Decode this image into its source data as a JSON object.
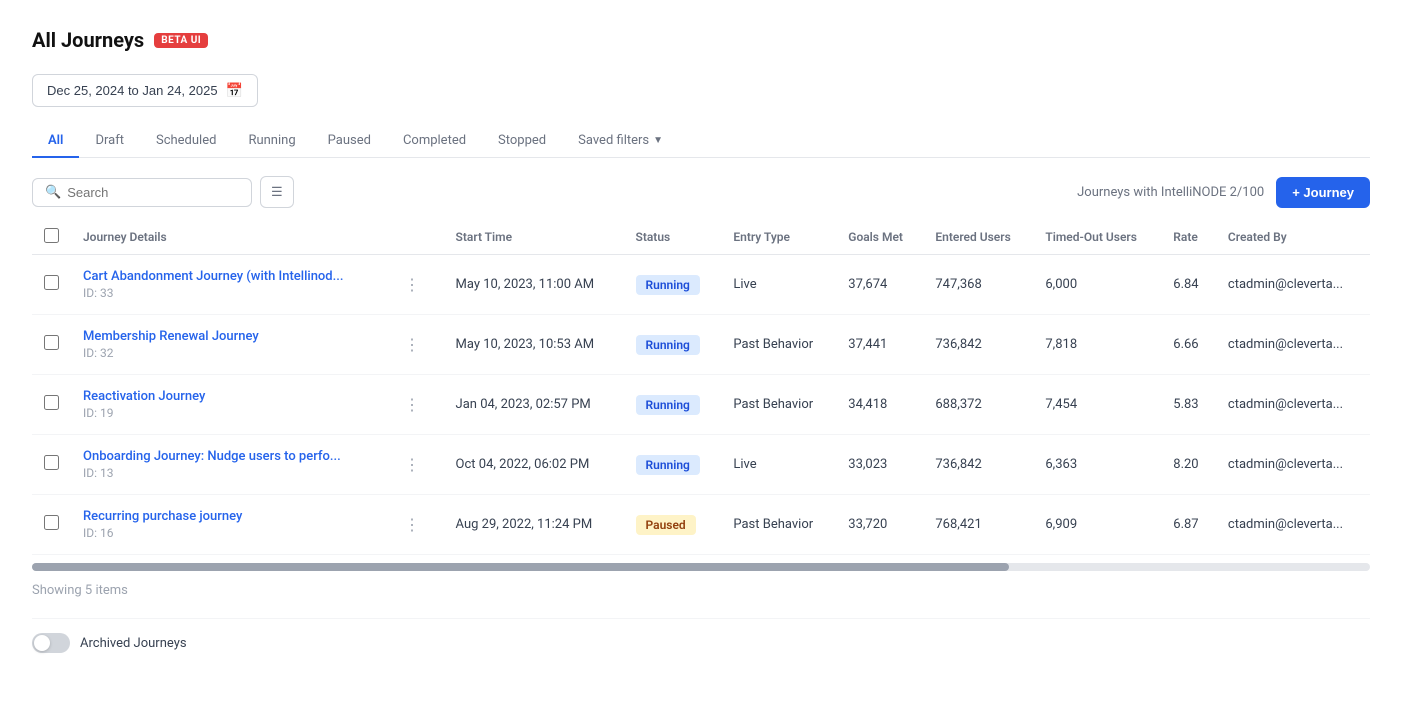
{
  "page": {
    "title": "All Journeys",
    "beta_badge": "BETA UI"
  },
  "date_range": {
    "label": "Dec 25, 2024 to Jan 24, 2025"
  },
  "tabs": [
    {
      "id": "all",
      "label": "All",
      "active": true
    },
    {
      "id": "draft",
      "label": "Draft",
      "active": false
    },
    {
      "id": "scheduled",
      "label": "Scheduled",
      "active": false
    },
    {
      "id": "running",
      "label": "Running",
      "active": false
    },
    {
      "id": "paused",
      "label": "Paused",
      "active": false
    },
    {
      "id": "completed",
      "label": "Completed",
      "active": false
    },
    {
      "id": "stopped",
      "label": "Stopped",
      "active": false
    },
    {
      "id": "saved_filters",
      "label": "Saved filters",
      "active": false
    }
  ],
  "toolbar": {
    "search_placeholder": "Search",
    "intellinode_text": "Journeys with IntelliNODE 2/100",
    "add_journey_label": "+ Journey"
  },
  "table": {
    "columns": [
      {
        "id": "checkbox",
        "label": ""
      },
      {
        "id": "journey_details",
        "label": "Journey Details"
      },
      {
        "id": "menu",
        "label": ""
      },
      {
        "id": "start_time",
        "label": "Start Time"
      },
      {
        "id": "status",
        "label": "Status"
      },
      {
        "id": "entry_type",
        "label": "Entry Type"
      },
      {
        "id": "goals_met",
        "label": "Goals Met"
      },
      {
        "id": "entered_users",
        "label": "Entered Users"
      },
      {
        "id": "timed_out_users",
        "label": "Timed-Out Users"
      },
      {
        "id": "rate",
        "label": "Rate"
      },
      {
        "id": "created_by",
        "label": "Created By"
      }
    ],
    "rows": [
      {
        "name": "Cart Abandonment Journey (with Intellinod...",
        "id": "ID: 33",
        "start_time": "May 10, 2023, 11:00 AM",
        "status": "Running",
        "status_type": "running",
        "entry_type": "Live",
        "goals_met": "37,674",
        "entered_users": "747,368",
        "timed_out_users": "6,000",
        "rate": "6.84",
        "created_by": "ctadmin@cleverta..."
      },
      {
        "name": "Membership Renewal Journey",
        "id": "ID: 32",
        "start_time": "May 10, 2023, 10:53 AM",
        "status": "Running",
        "status_type": "running",
        "entry_type": "Past Behavior",
        "goals_met": "37,441",
        "entered_users": "736,842",
        "timed_out_users": "7,818",
        "rate": "6.66",
        "created_by": "ctadmin@cleverta..."
      },
      {
        "name": "Reactivation Journey",
        "id": "ID: 19",
        "start_time": "Jan 04, 2023, 02:57 PM",
        "status": "Running",
        "status_type": "running",
        "entry_type": "Past Behavior",
        "goals_met": "34,418",
        "entered_users": "688,372",
        "timed_out_users": "7,454",
        "rate": "5.83",
        "created_by": "ctadmin@cleverta..."
      },
      {
        "name": "Onboarding Journey: Nudge users to perfo...",
        "id": "ID: 13",
        "start_time": "Oct 04, 2022, 06:02 PM",
        "status": "Running",
        "status_type": "running",
        "entry_type": "Live",
        "goals_met": "33,023",
        "entered_users": "736,842",
        "timed_out_users": "6,363",
        "rate": "8.20",
        "created_by": "ctadmin@cleverta..."
      },
      {
        "name": "Recurring purchase journey",
        "id": "ID: 16",
        "start_time": "Aug 29, 2022, 11:24 PM",
        "status": "Paused",
        "status_type": "paused",
        "entry_type": "Past Behavior",
        "goals_met": "33,720",
        "entered_users": "768,421",
        "timed_out_users": "6,909",
        "rate": "6.87",
        "created_by": "ctadmin@cleverta..."
      }
    ]
  },
  "footer": {
    "showing_label": "Showing 5 items"
  },
  "archived": {
    "label": "Archived Journeys"
  }
}
